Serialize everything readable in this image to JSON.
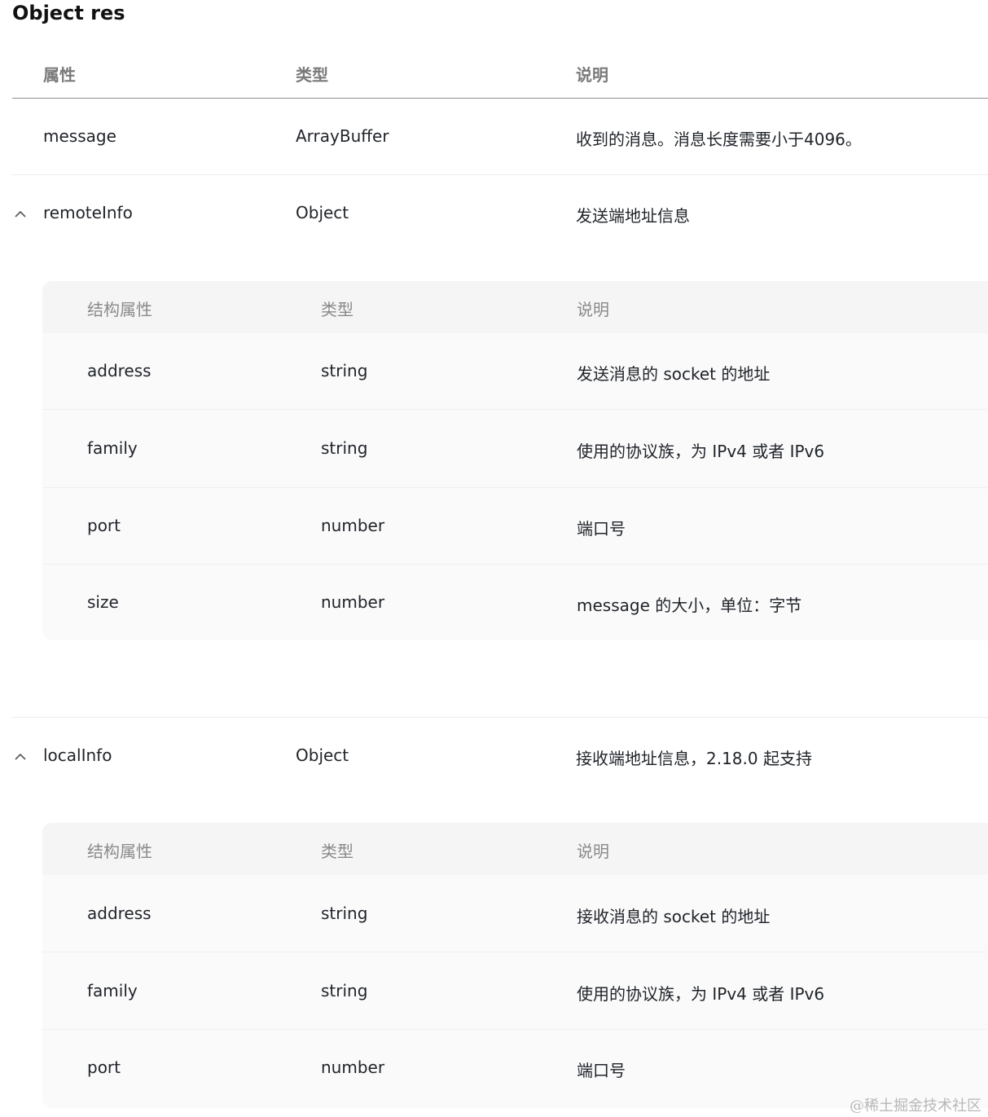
{
  "title": "Object res",
  "table": {
    "headers": [
      "属性",
      "类型",
      "说明"
    ],
    "rows": [
      {
        "name": "message",
        "type": "ArrayBuffer",
        "desc": "收到的消息。消息长度需要小于4096。"
      },
      {
        "name": "remoteInfo",
        "type": "Object",
        "desc": "发送端地址信息"
      },
      {
        "name": "localInfo",
        "type": "Object",
        "desc": "接收端地址信息，2.18.0 起支持"
      }
    ]
  },
  "remoteInfo": {
    "headers": [
      "结构属性",
      "类型",
      "说明"
    ],
    "rows": [
      {
        "name": "address",
        "type": "string",
        "desc": "发送消息的 socket 的地址"
      },
      {
        "name": "family",
        "type": "string",
        "desc": "使用的协议族，为 IPv4 或者 IPv6"
      },
      {
        "name": "port",
        "type": "number",
        "desc": "端口号"
      },
      {
        "name": "size",
        "type": "number",
        "desc": "message 的大小，单位：字节"
      }
    ]
  },
  "localInfo": {
    "headers": [
      "结构属性",
      "类型",
      "说明"
    ],
    "rows": [
      {
        "name": "address",
        "type": "string",
        "desc": "接收消息的 socket 的地址"
      },
      {
        "name": "family",
        "type": "string",
        "desc": "使用的协议族，为 IPv4 或者 IPv6"
      },
      {
        "name": "port",
        "type": "number",
        "desc": "端口号"
      }
    ]
  },
  "icons": {
    "expand": "chevron-up-icon"
  },
  "colors": {
    "header_text": "#7a7a7a",
    "nested_bg": "#fafafa",
    "nested_header_bg": "#f5f5f5"
  },
  "watermark": "@稀土掘金技术社区"
}
